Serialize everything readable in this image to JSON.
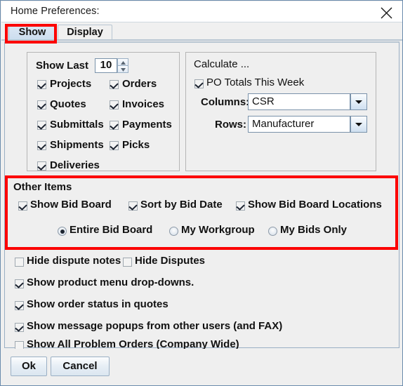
{
  "window": {
    "title": "Home Preferences:",
    "close_icon": "close-icon"
  },
  "tabs": [
    {
      "label": "Show",
      "selected": true
    },
    {
      "label": "Display",
      "selected": false
    }
  ],
  "show_last_group": {
    "title": "Show Last",
    "spinner_value": "10",
    "checkboxes": [
      {
        "label": "Projects",
        "checked": true
      },
      {
        "label": "Orders",
        "checked": true
      },
      {
        "label": "Quotes",
        "checked": true
      },
      {
        "label": "Invoices",
        "checked": true
      },
      {
        "label": "Submittals",
        "checked": true
      },
      {
        "label": "Payments",
        "checked": true
      },
      {
        "label": "Shipments",
        "checked": true
      },
      {
        "label": "Picks",
        "checked": true
      },
      {
        "label": "Deliveries",
        "checked": true
      }
    ]
  },
  "calculate_group": {
    "title": "Calculate ...",
    "po_totals": {
      "label": "PO Totals This Week",
      "checked": true
    },
    "columns": {
      "label": "Columns:",
      "value": "CSR"
    },
    "rows": {
      "label": "Rows:",
      "value": "Manufacturer"
    }
  },
  "other_items": {
    "title": "Other Items",
    "checkboxes": [
      {
        "label": "Show Bid Board",
        "checked": true
      },
      {
        "label": "Sort by Bid Date",
        "checked": true
      },
      {
        "label": "Show Bid Board Locations",
        "checked": true
      }
    ],
    "radios": [
      {
        "label": "Entire Bid Board",
        "checked": true
      },
      {
        "label": "My Workgroup",
        "checked": false
      },
      {
        "label": "My Bids Only",
        "checked": false
      }
    ]
  },
  "general_options": [
    {
      "label": "Hide dispute notes",
      "checked": false
    },
    {
      "label": "Hide Disputes",
      "checked": false
    },
    {
      "label": "Show product menu drop-downs.",
      "checked": true
    },
    {
      "label": "Show order status in quotes",
      "checked": true
    },
    {
      "label": "Show message popups from other users (and FAX)",
      "checked": true
    },
    {
      "label": "Show All Problem Orders (Company Wide)",
      "checked": false
    }
  ],
  "buttons": {
    "ok": "Ok",
    "cancel": "Cancel"
  },
  "highlights": {
    "accent_color": "#fc0000"
  }
}
